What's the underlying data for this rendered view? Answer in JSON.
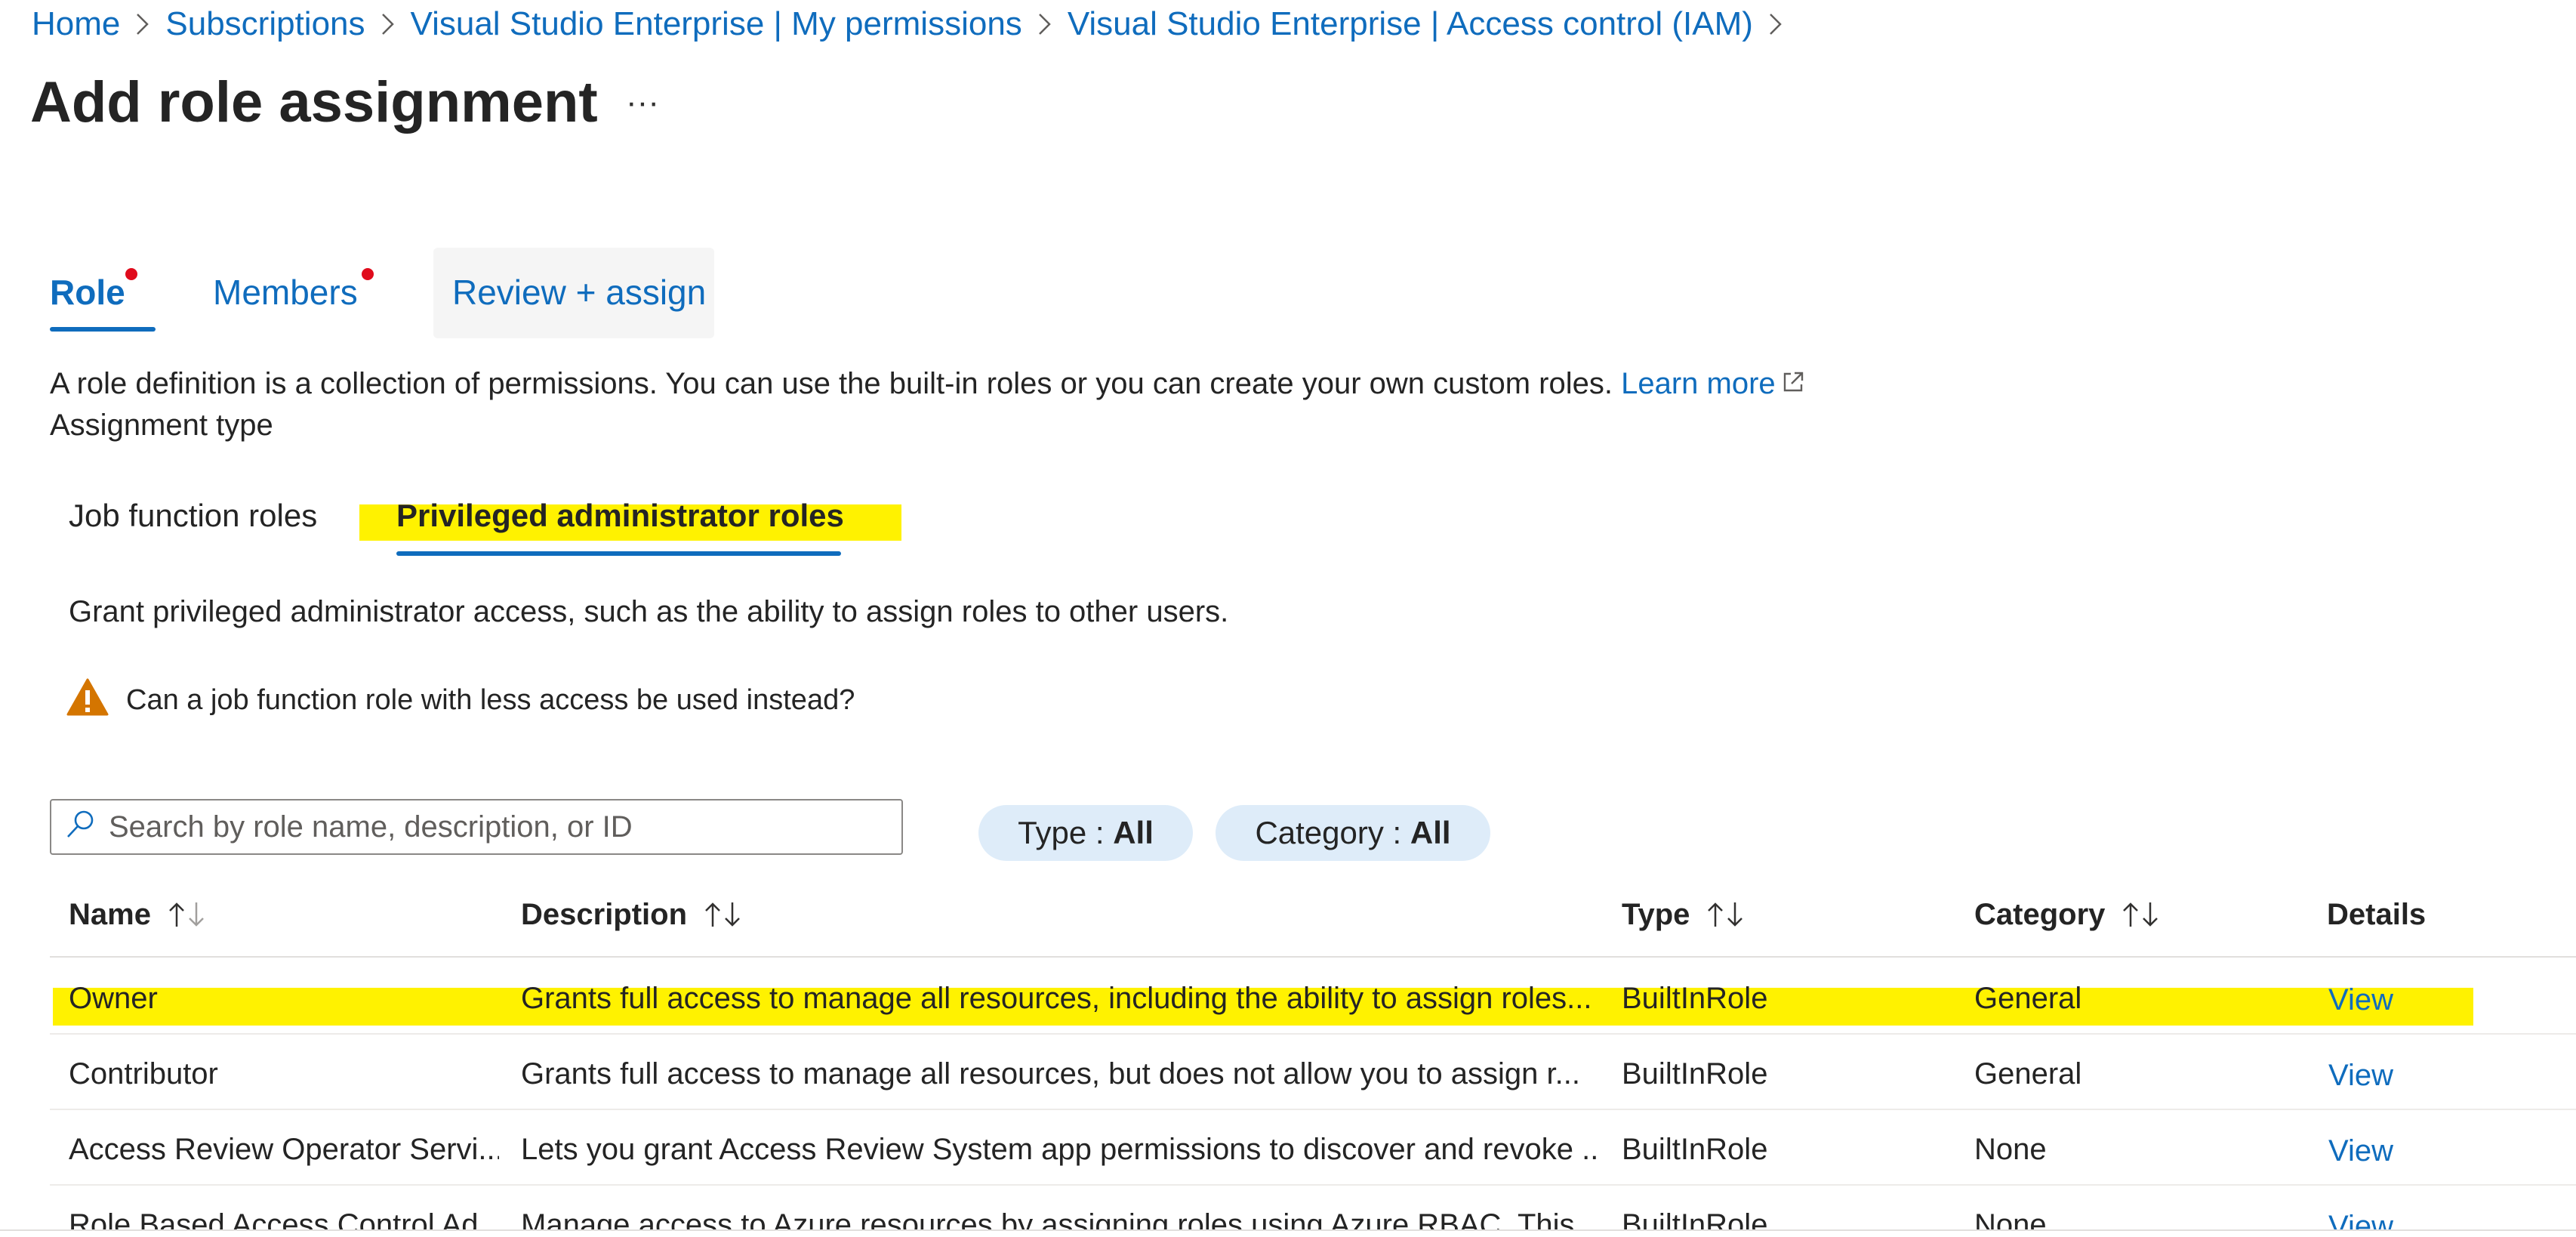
{
  "breadcrumb": {
    "items": [
      "Home",
      "Subscriptions",
      "Visual Studio Enterprise | My permissions",
      "Visual Studio Enterprise | Access control (IAM)"
    ]
  },
  "page": {
    "title": "Add role assignment",
    "more_label": "···"
  },
  "tabs": {
    "role": "Role",
    "members": "Members",
    "review": "Review + assign"
  },
  "role_tab": {
    "description": "A role definition is a collection of permissions. You can use the built-in roles or you can create your own custom roles.",
    "learn_more": "Learn more",
    "assignment_type_label": "Assignment type",
    "subtabs": {
      "job": "Job function roles",
      "privileged": "Privileged administrator roles"
    },
    "grant_text": "Grant privileged administrator access, such as the ability to assign roles to other users.",
    "warning_text": "Can a job function role with less access be used instead?"
  },
  "search": {
    "placeholder": "Search by role name, description, or ID",
    "value": ""
  },
  "filters": {
    "type": {
      "label": "Type : ",
      "value": "All"
    },
    "category": {
      "label": "Category : ",
      "value": "All"
    }
  },
  "table": {
    "columns": {
      "name": "Name",
      "description": "Description",
      "type": "Type",
      "category": "Category",
      "details": "Details"
    },
    "rows": [
      {
        "name": "Owner",
        "description": "Grants full access to manage all resources, including the ability to assign roles...",
        "type": "BuiltInRole",
        "category": "General",
        "details": "View"
      },
      {
        "name": "Contributor",
        "description": "Grants full access to manage all resources, but does not allow you to assign r...",
        "type": "BuiltInRole",
        "category": "General",
        "details": "View"
      },
      {
        "name": "Access Review Operator Servi...",
        "description": "Lets you grant Access Review System app permissions to discover and revoke ...",
        "type": "BuiltInRole",
        "category": "None",
        "details": "View"
      },
      {
        "name": "Role Based Access Control Ad...",
        "description": "Manage access to Azure resources by assigning roles using Azure RBAC. This ...",
        "type": "BuiltInRole",
        "category": "None",
        "details": "View"
      }
    ]
  },
  "colors": {
    "link": "#0f6cbd",
    "highlight": "#fff200",
    "required": "#e00b1c",
    "warning": "#d47500",
    "pill": "#deecf9"
  }
}
